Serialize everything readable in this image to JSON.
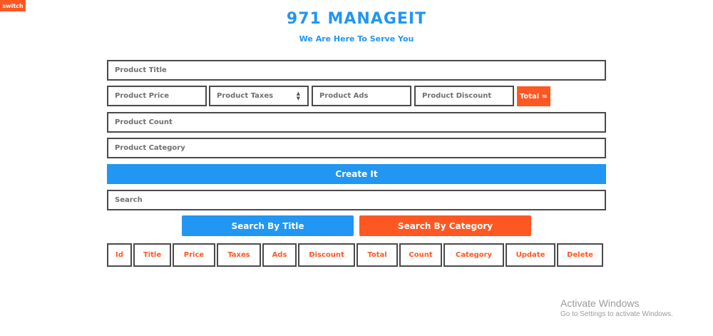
{
  "header": {
    "switch_label": "switch",
    "title": "971 MANAGEIT",
    "subtitle": "We Are Here To Serve You"
  },
  "form": {
    "product_title_placeholder": "Product Title",
    "product_price_placeholder": "Product Price",
    "product_taxes_placeholder": "Product Taxes",
    "product_ads_placeholder": "Product Ads",
    "product_discount_placeholder": "Product Discount",
    "total_label": "Total =",
    "product_count_placeholder": "Product Count",
    "product_category_placeholder": "Product Category",
    "create_label": "Create It"
  },
  "search": {
    "placeholder": "Search",
    "by_title_label": "Search By Title",
    "by_category_label": "Search By Category"
  },
  "table": {
    "headers": [
      "Id",
      "Title",
      "Price",
      "Taxes",
      "Ads",
      "Discount",
      "Total",
      "Count",
      "Category",
      "Update",
      "Delete"
    ]
  },
  "watermark": {
    "title": "Activate Windows",
    "subtitle": "Go to Settings to activate Windows."
  },
  "colors": {
    "accent_blue": "#2196f3",
    "accent_orange": "#ff5722",
    "border": "#4a4a4a"
  }
}
